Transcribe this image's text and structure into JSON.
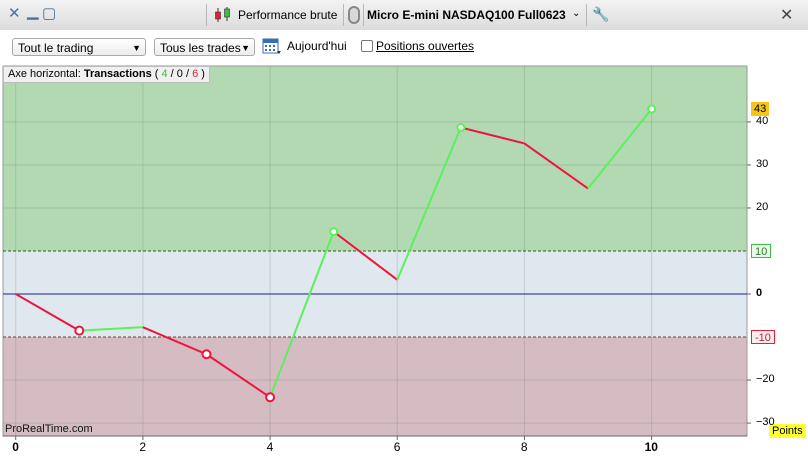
{
  "window": {
    "close_glyph": "✕",
    "minimize_glyph": "▁",
    "restore_glyph": "▢",
    "report_label": "Performance brute",
    "instrument": "Micro E-mini NASDAQ100 Full0623",
    "chevron_glyph": "⌄",
    "wrench_glyph": "🔧",
    "close_right_glyph": "✕"
  },
  "toolbar": {
    "mode_select": "Tout le trading",
    "trades_select": "Tous les trades",
    "today_label": "Aujourd'hui",
    "open_positions_label": "Positions ouvertes",
    "open_positions_checked": false
  },
  "chart_header": {
    "prefix": "Axe horizontal: ",
    "axis_name": "Transactions",
    "open_paren": " ( ",
    "wins": "4",
    "sep1": " / ",
    "neutral": "0",
    "sep2": " / ",
    "losses": "6",
    "close_paren": " )"
  },
  "watermark": "ProRealTime.com",
  "units_badge": "Points",
  "colors": {
    "gain_line": "#5cf05c",
    "loss_line": "#f0143c",
    "profit_zone": "#b2d9b2",
    "neutral_zone": "#dfe8ee",
    "loss_zone": "#d4bcc2",
    "zero_line": "#1a237e",
    "last_value_tag": "#f5c518"
  },
  "chart_data": {
    "type": "line",
    "x": [
      0,
      1,
      2,
      3,
      4,
      5,
      6,
      7,
      8,
      9,
      10
    ],
    "y": [
      0,
      -8.5,
      -7.7,
      -14,
      -24,
      14.5,
      3.3,
      38.7,
      35,
      24.5,
      43
    ],
    "trade_results": [
      "start",
      "loss",
      "gain",
      "loss",
      "loss",
      "gain",
      "loss",
      "gain",
      "loss",
      "loss",
      "gain"
    ],
    "ylim": [
      -33,
      53
    ],
    "xlim": [
      -0.2,
      11.5
    ],
    "y_ticks": [
      "40",
      "30",
      "20",
      "0",
      "−20",
      "−30"
    ],
    "x_ticks": [
      "0",
      "2",
      "4",
      "6",
      "8",
      "10"
    ],
    "thresholds": {
      "upper": 10,
      "lower": -10,
      "upper_label": "10",
      "lower_label": "-10"
    },
    "last_value_label": "43"
  }
}
